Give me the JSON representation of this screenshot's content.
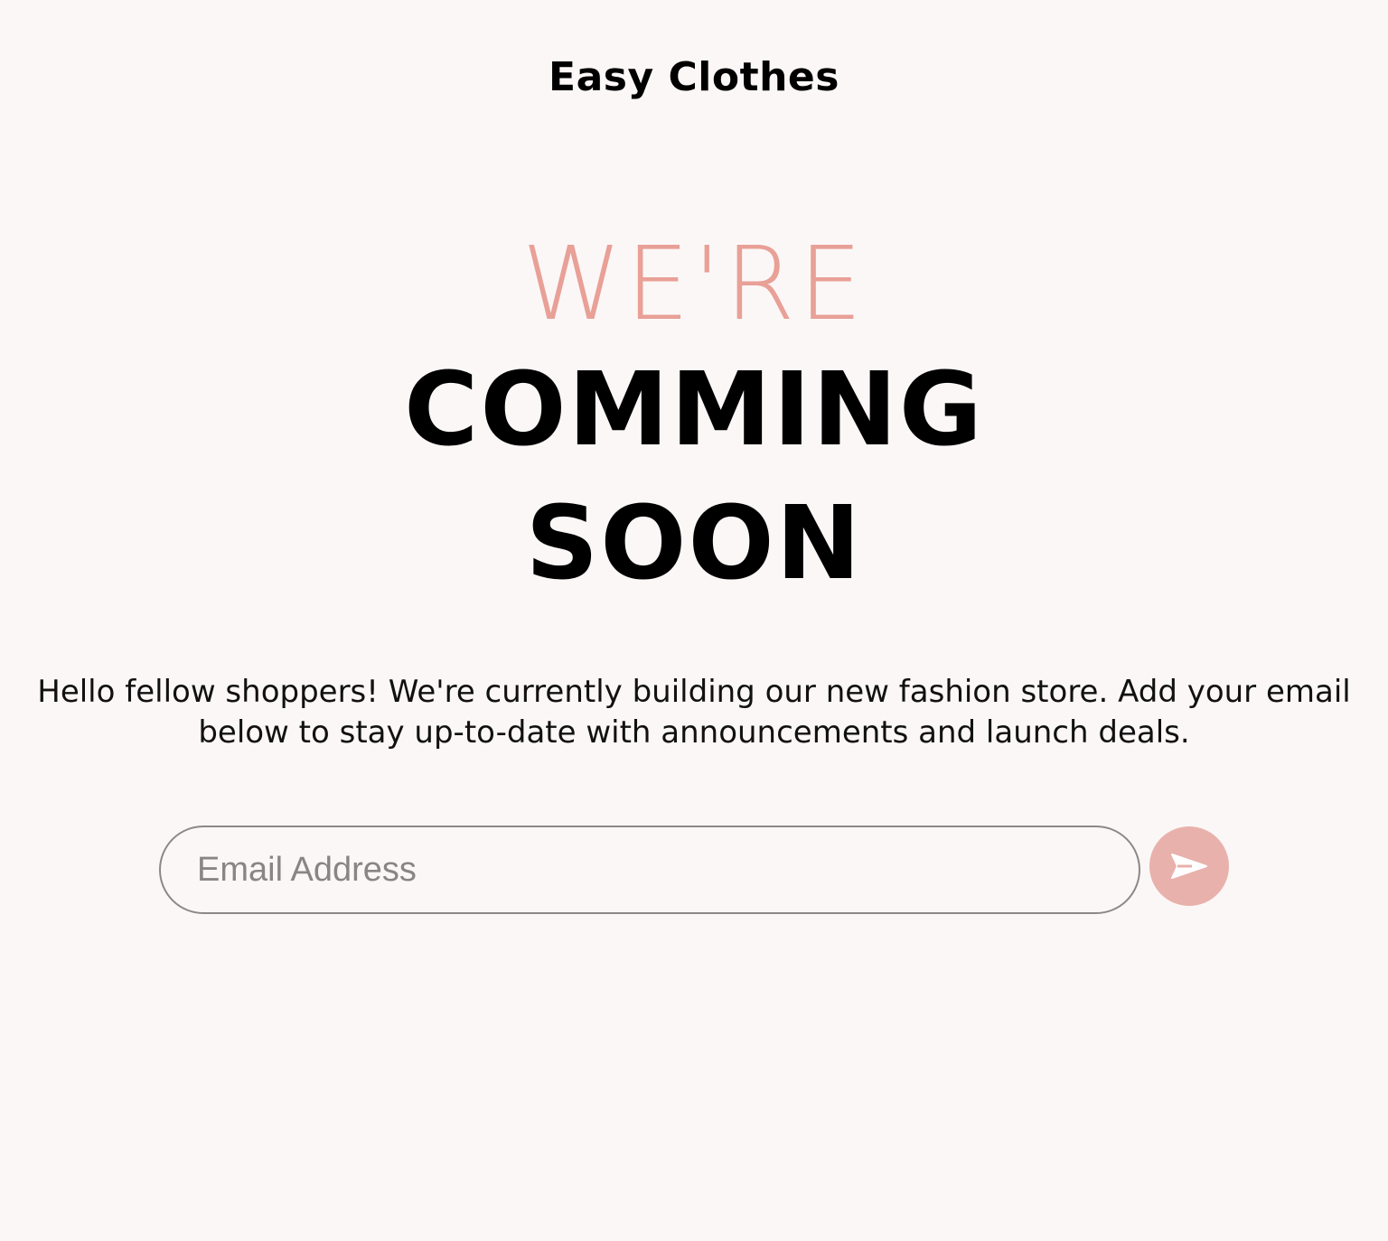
{
  "brand": {
    "name": "Easy Clothes"
  },
  "hero": {
    "line1": "WE'RE",
    "line2": "COMMING",
    "line3": "SOON"
  },
  "intro": {
    "text": "Hello fellow shoppers! We're currently building our new fashion store. Add your email below to stay up-to-date with announcements and launch deals."
  },
  "signup": {
    "email_placeholder": "Email Address",
    "email_value": "",
    "submit_icon": "send-arrow-icon"
  },
  "colors": {
    "background": "#fcf7f7",
    "accent": "#e8a097",
    "button": "#e9b1ab",
    "text": "#000000"
  }
}
